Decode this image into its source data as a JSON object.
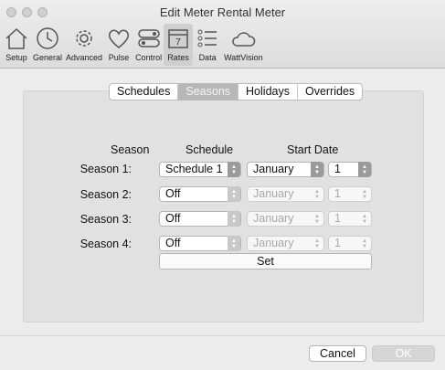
{
  "window": {
    "title": "Edit Meter Rental Meter"
  },
  "toolbar": {
    "items": [
      {
        "label": "Setup",
        "icon": "house-icon"
      },
      {
        "label": "General",
        "icon": "clock-icon"
      },
      {
        "label": "Advanced",
        "icon": "gear-icon"
      },
      {
        "label": "Pulse",
        "icon": "heart-icon"
      },
      {
        "label": "Control",
        "icon": "toggle-icon"
      },
      {
        "label": "Rates",
        "icon": "calendar-icon",
        "selected": true,
        "calendar_day": "7"
      },
      {
        "label": "Data",
        "icon": "list-icon"
      },
      {
        "label": "WattVision",
        "icon": "cloud-icon"
      }
    ]
  },
  "tabs": [
    {
      "label": "Schedules"
    },
    {
      "label": "Seasons",
      "active": true
    },
    {
      "label": "Holidays"
    },
    {
      "label": "Overrides"
    }
  ],
  "table": {
    "headers": {
      "season": "Season",
      "schedule": "Schedule",
      "start_date": "Start Date"
    },
    "rows": [
      {
        "label": "Season 1:",
        "schedule": "Schedule 1",
        "month": "January",
        "day": "1",
        "enabled": true
      },
      {
        "label": "Season 2:",
        "schedule": "Off",
        "month": "January",
        "day": "1",
        "enabled": false
      },
      {
        "label": "Season 3:",
        "schedule": "Off",
        "month": "January",
        "day": "1",
        "enabled": false
      },
      {
        "label": "Season 4:",
        "schedule": "Off",
        "month": "January",
        "day": "1",
        "enabled": false
      }
    ],
    "set_label": "Set"
  },
  "footer": {
    "cancel_label": "Cancel",
    "ok_label": "OK"
  }
}
